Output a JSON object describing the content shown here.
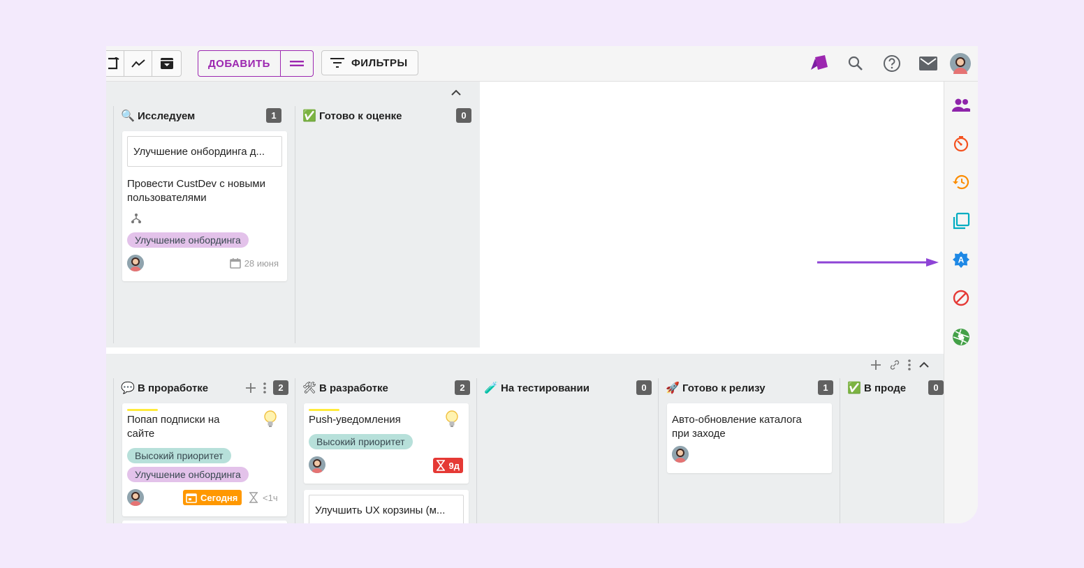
{
  "colors": {
    "page_bg": "#f3eafc",
    "accent_purple": "#9c27b0",
    "lane_bg": "#eceeef",
    "count_badge": "#616161",
    "tag_purple": "#e3c2ea",
    "tag_teal": "#b7e0da",
    "today_badge": "#ff9800",
    "overdue_badge": "#e53935",
    "arrow": "#8e44d6"
  },
  "toolbar": {
    "add_label": "ДОБАВИТЬ",
    "filters_label": "ФИЛЬТРЫ",
    "left_icons": [
      "board-icon",
      "chart-icon",
      "archive-icon"
    ],
    "right_icons": [
      "brand-icon",
      "search-icon",
      "help-icon",
      "mail-icon",
      "avatar"
    ]
  },
  "sidebar": {
    "icons": [
      "people-icon",
      "timer-icon",
      "history-icon",
      "copy-icon",
      "auto-badge-icon",
      "block-icon",
      "aperture-icon"
    ]
  },
  "top_lane": {
    "columns": [
      {
        "emoji": "🔍",
        "title": "Исследуем",
        "count": "1",
        "cards": [
          {
            "subcard": "Улучшение онбординга д...",
            "title": "Провести CustDev с новыми пользователями",
            "tags": [
              "Улучшение онбординга"
            ],
            "due": "28 июня"
          }
        ]
      },
      {
        "emoji": "✅",
        "title": "Готово к оценке",
        "count": "0"
      }
    ]
  },
  "bottom_lane": {
    "columns": [
      {
        "emoji": "💬",
        "title": "В проработке",
        "count": "2",
        "cards": [
          {
            "title": "Попап подписки на сайте",
            "tags": [
              "Высокий приоритет",
              "Улучшение онбординга"
            ],
            "today": "Сегодня",
            "estimate": "<1ч"
          }
        ]
      },
      {
        "emoji": "🛠",
        "title": "В разработке",
        "count": "2",
        "cards": [
          {
            "title": "Push-уведомления",
            "tags": [
              "Высокий приоритет"
            ],
            "days": "9д"
          },
          {
            "subcard": "Улучшить UX корзины (м..."
          }
        ]
      },
      {
        "emoji": "🧪",
        "title": "На тестировании",
        "count": "0"
      },
      {
        "emoji": "🚀",
        "title": "Готово к релизу",
        "count": "1",
        "cards": [
          {
            "title": "Авто-обновление каталога при заходе"
          }
        ]
      },
      {
        "emoji": "✅",
        "title": "В проде",
        "count": "0"
      }
    ]
  }
}
